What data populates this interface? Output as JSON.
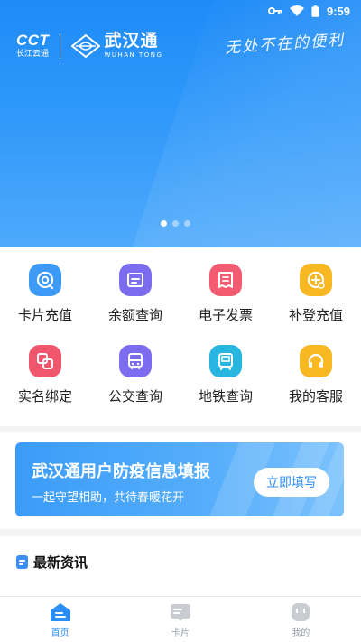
{
  "status_bar": {
    "time": "9:59",
    "key_icon": "key-icon",
    "wifi_icon": "wifi-icon",
    "battery_icon": "battery-icon"
  },
  "hero": {
    "cct_title": "CCT",
    "cct_subtitle": "长江云通",
    "brand_cn": "武汉通",
    "brand_en": "WUHAN TONG",
    "slogan": "无处不在的便利",
    "carousel_pages": 3,
    "carousel_active": 0,
    "colors": {
      "top": "#1e8bf7",
      "bottom": "#4ea9fb"
    }
  },
  "grid": [
    {
      "label": "卡片充值",
      "icon": "card-recharge-icon",
      "color": "#3d9bf7"
    },
    {
      "label": "余额查询",
      "icon": "balance-query-icon",
      "color": "#7b6cf0"
    },
    {
      "label": "电子发票",
      "icon": "e-invoice-icon",
      "color": "#f25b70"
    },
    {
      "label": "补登充值",
      "icon": "topup-register-icon",
      "color": "#f7b821"
    },
    {
      "label": "实名绑定",
      "icon": "realname-bind-icon",
      "color": "#f0566c"
    },
    {
      "label": "公交查询",
      "icon": "bus-query-icon",
      "color": "#7b6cf0"
    },
    {
      "label": "地铁查询",
      "icon": "metro-query-icon",
      "color": "#28b6e0"
    },
    {
      "label": "我的客服",
      "icon": "customer-service-icon",
      "color": "#f7b821"
    }
  ],
  "promo": {
    "title": "武汉通用户防疫信息填报",
    "subtitle": "一起守望相助，共待春暖花开",
    "button": "立即填写"
  },
  "news": {
    "title": "最新资讯"
  },
  "bottom_nav": [
    {
      "label": "首页",
      "icon": "home-icon",
      "active": true
    },
    {
      "label": "卡片",
      "icon": "card-icon",
      "active": false
    },
    {
      "label": "我的",
      "icon": "profile-icon",
      "active": false
    }
  ],
  "accent": "#2b8ef6"
}
